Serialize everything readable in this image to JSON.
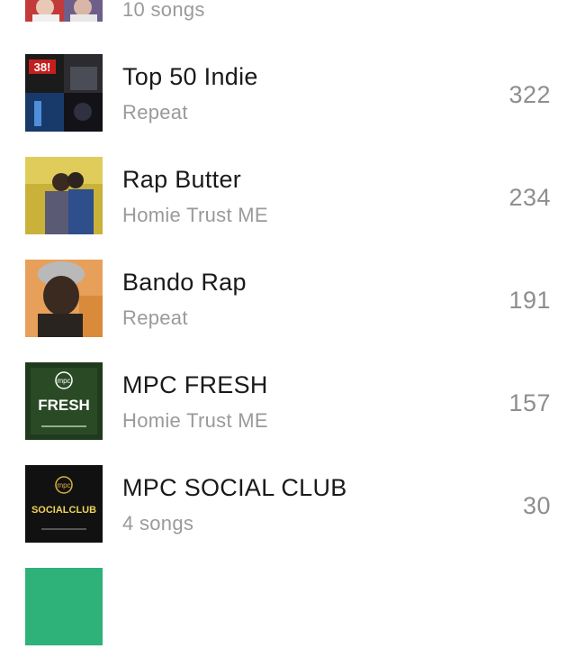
{
  "playlists": [
    {
      "title": "",
      "subtitle": "10 songs",
      "count": "",
      "art_icon": "playlist-cover-collage-icon"
    },
    {
      "title": "Top 50 Indie",
      "subtitle": "Repeat",
      "count": "322",
      "art_icon": "playlist-cover-collage-icon"
    },
    {
      "title": "Rap Butter",
      "subtitle": "Homie Trust ME",
      "count": "234",
      "art_icon": "playlist-cover-photo-icon"
    },
    {
      "title": "Bando Rap",
      "subtitle": "Repeat",
      "count": "191",
      "art_icon": "playlist-cover-portrait-icon"
    },
    {
      "title": "MPC FRESH",
      "subtitle": "Homie Trust ME",
      "count": "157",
      "art_icon": "playlist-cover-mpc-fresh-icon",
      "art_text": "FRESH",
      "art_logo": "mpc"
    },
    {
      "title": "MPC SOCIAL CLUB",
      "subtitle": "4 songs",
      "count": "30",
      "art_icon": "playlist-cover-mpc-social-icon",
      "art_text": "SOCIALCLUB",
      "art_logo": "mpc"
    },
    {
      "title": "",
      "subtitle": "",
      "count": "",
      "art_icon": "playlist-cover-icon"
    }
  ],
  "colors": {
    "title": "#1a1a1a",
    "subtitle": "#9a9a9a",
    "count": "#8e8e8e",
    "fresh_bg": "#1f3a1c",
    "social_bg": "#111111",
    "mpc_accent": "#d9b43a"
  }
}
